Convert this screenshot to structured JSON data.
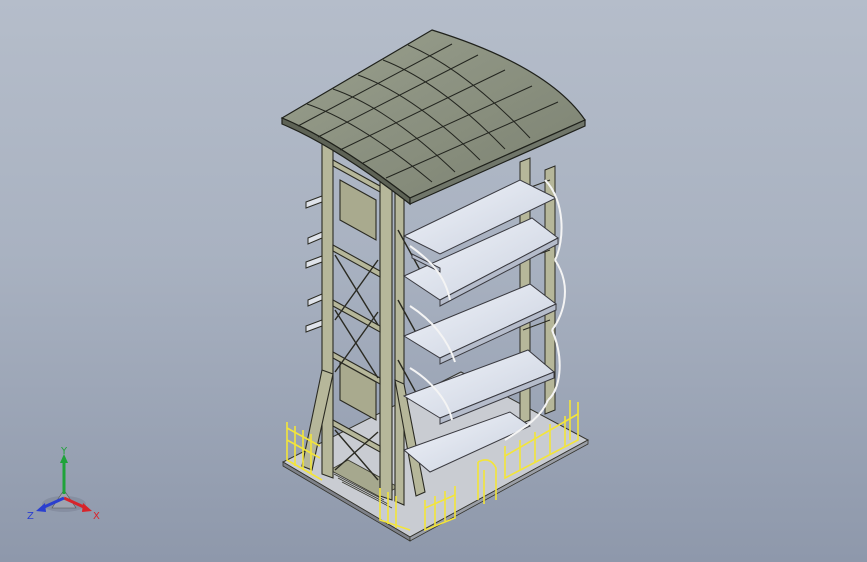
{
  "viewport": {
    "background_top": "#b5bdca",
    "background_bottom": "#8e98ab"
  },
  "model": {
    "frame_color": "#b6b79a",
    "frame_edge": "#2a2a22",
    "roof_color": "#8f9582",
    "shelf_color": "#e4e9f2",
    "railing_color": "#f3e53a"
  },
  "triad": {
    "x_label": "X",
    "y_label": "Y",
    "z_label": "Z",
    "x_color": "#d8242a",
    "y_color": "#1fa33a",
    "z_color": "#2a3fd0"
  }
}
